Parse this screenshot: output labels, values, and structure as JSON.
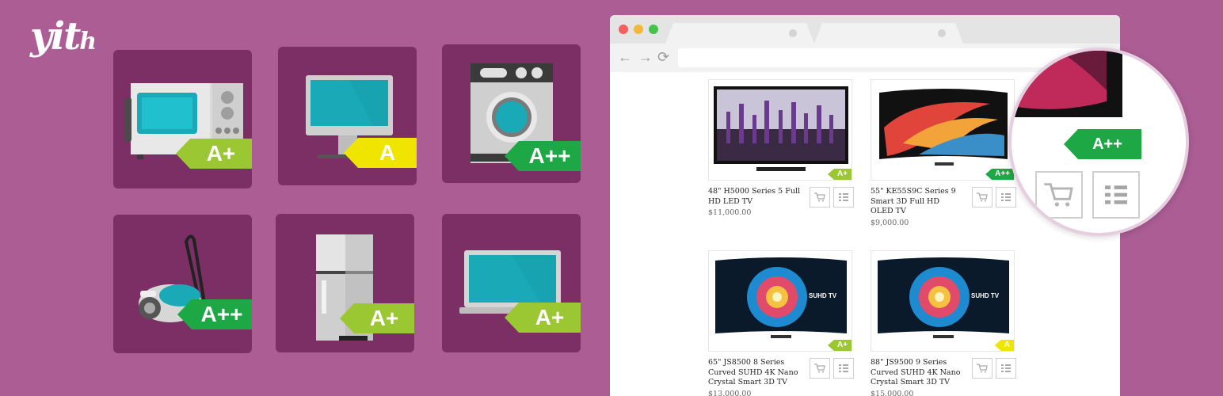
{
  "brand": {
    "logo_main": "yit",
    "logo_small": "h"
  },
  "tiles": [
    {
      "icon": "microwave-icon",
      "rating": "A+"
    },
    {
      "icon": "desktop-computer-icon",
      "rating": "A"
    },
    {
      "icon": "washing-machine-icon",
      "rating": "A++"
    },
    {
      "icon": "vacuum-cleaner-icon",
      "rating": "A++"
    },
    {
      "icon": "refrigerator-icon",
      "rating": "A+"
    },
    {
      "icon": "laptop-icon",
      "rating": "A+"
    }
  ],
  "colors": {
    "background": "#ab5d94",
    "tile": "#7c2f64",
    "rating_a_plus": "#9bc732",
    "rating_a": "#f0e500",
    "rating_a_plus_plus": "#1da845"
  },
  "browser": {
    "nav": {
      "back": "←",
      "forward": "→",
      "reload": "⟳"
    },
    "products": [
      {
        "name": "48\" H5000 Series 5 Full HD LED TV",
        "price": "$11,000.00",
        "rating": "A+"
      },
      {
        "name": "55\" KE55S9C Series 9 Smart 3D Full HD OLED TV",
        "price": "$9,000.00",
        "rating": "A++"
      },
      {
        "name": "65\" JS8500 8 Series Curved SUHD 4K Nano Crystal Smart 3D TV",
        "price": "$13,000.00",
        "rating": "A+"
      },
      {
        "name": "88\" JS9500 9 Series Curved SUHD 4K Nano Crystal Smart 3D TV",
        "price": "$15,000.00",
        "rating": "A"
      }
    ],
    "screen_brand": "SUHD TV"
  },
  "zoom": {
    "rating": "A++"
  }
}
